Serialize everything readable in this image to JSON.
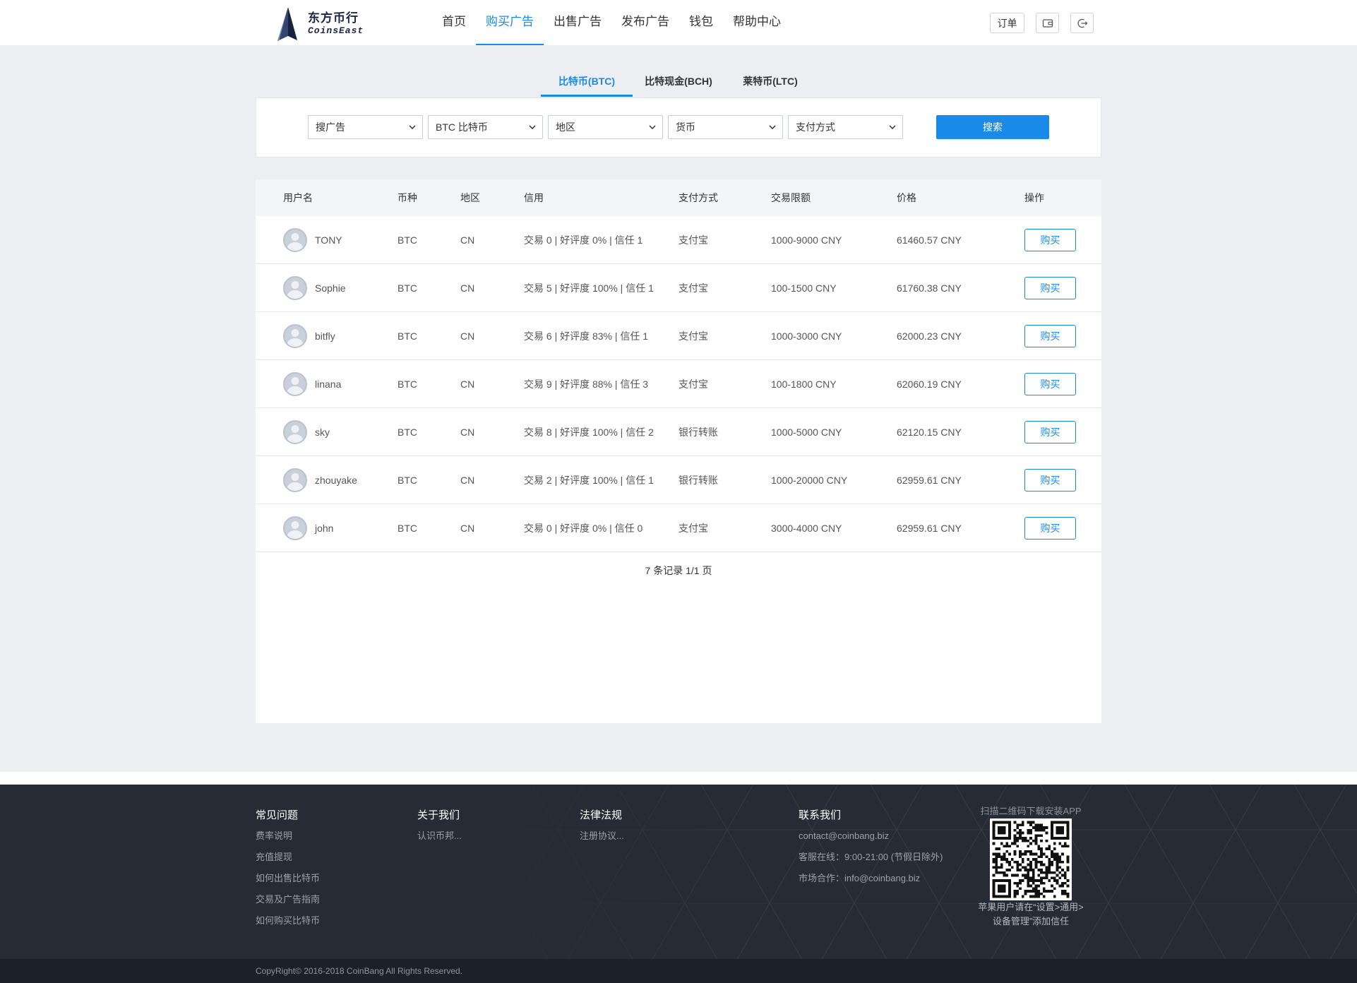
{
  "header": {
    "logo": {
      "name": "东方币行",
      "sub": "CoinsEast"
    },
    "nav": [
      {
        "label": "首页"
      },
      {
        "label": "购买广告",
        "active": true
      },
      {
        "label": "出售广告"
      },
      {
        "label": "发布广告"
      },
      {
        "label": "钱包"
      },
      {
        "label": "帮助中心"
      }
    ],
    "actions": {
      "orders_label": "订单",
      "wallet_icon": "wallet-icon",
      "logout_icon": "logout-icon"
    }
  },
  "coin_tabs": [
    {
      "label": "比特币(BTC)",
      "active": true
    },
    {
      "label": "比特现金(BCH)"
    },
    {
      "label": "莱特币(LTC)"
    }
  ],
  "filters": {
    "selects": [
      {
        "value": "搜广告"
      },
      {
        "value": "BTC 比特币"
      },
      {
        "value": "地区"
      },
      {
        "value": "货币"
      },
      {
        "value": "支付方式"
      }
    ],
    "search_label": "搜索"
  },
  "table": {
    "columns": [
      "用户名",
      "币种",
      "地区",
      "信用",
      "支付方式",
      "交易限额",
      "价格",
      "操作"
    ],
    "action_label": "购买",
    "rows": [
      {
        "user": "TONY",
        "coin": "BTC",
        "region": "CN",
        "credit": "交易 0 | 好评度 0% | 信任 1",
        "payment": "支付宝",
        "limit": "1000-9000 CNY",
        "price": "61460.57 CNY"
      },
      {
        "user": "Sophie",
        "coin": "BTC",
        "region": "CN",
        "credit": "交易 5 | 好评度 100% | 信任 1",
        "payment": "支付宝",
        "limit": "100-1500 CNY",
        "price": "61760.38 CNY"
      },
      {
        "user": "bitfly",
        "coin": "BTC",
        "region": "CN",
        "credit": "交易 6 | 好评度 83% | 信任 1",
        "payment": "支付宝",
        "limit": "1000-3000 CNY",
        "price": "62000.23 CNY"
      },
      {
        "user": "linana",
        "coin": "BTC",
        "region": "CN",
        "credit": "交易 9 | 好评度 88% | 信任 3",
        "payment": "支付宝",
        "limit": "100-1800 CNY",
        "price": "62060.19 CNY"
      },
      {
        "user": "sky",
        "coin": "BTC",
        "region": "CN",
        "credit": "交易 8 | 好评度 100% | 信任 2",
        "payment": "银行转账",
        "limit": "1000-5000 CNY",
        "price": "62120.15 CNY"
      },
      {
        "user": "zhouyake",
        "coin": "BTC",
        "region": "CN",
        "credit": "交易 2 | 好评度 100% | 信任 1",
        "payment": "银行转账",
        "limit": "1000-20000 CNY",
        "price": "62959.61 CNY"
      },
      {
        "user": "john",
        "coin": "BTC",
        "region": "CN",
        "credit": "交易 0 | 好评度 0% | 信任 0",
        "payment": "支付宝",
        "limit": "3000-4000 CNY",
        "price": "62959.61 CNY"
      }
    ]
  },
  "pagination": {
    "text": "7 条记录 1/1 页"
  },
  "footer": {
    "faq": {
      "title": "常见问题",
      "items": [
        "费率说明",
        "充值提现",
        "如何出售比特币",
        "交易及广告指南",
        "如何购买比特币"
      ]
    },
    "about": {
      "title": "关于我们",
      "items": [
        "认识币邦..."
      ]
    },
    "legal": {
      "title": "法律法规",
      "items": [
        "注册协议..."
      ]
    },
    "contact": {
      "title": "联系我们",
      "items": [
        "contact@coinbang.biz",
        "客服在线：9:00-21:00 (节假日除外)",
        "市场合作：info@coinbang.biz"
      ]
    },
    "app": {
      "title": "扫描二维码下载安装APP",
      "note_lines": [
        "苹果用户请在“设置>通用>",
        "设备管理”添加信任"
      ]
    }
  },
  "copyright": "CopyRight© 2016-2018 CoinBang All Rights Reserved.",
  "colors": {
    "accent": "#1a8ae8",
    "page_bg": "#eceef1",
    "footer_bg": "#262b35",
    "footer_bottom_bg": "#1c2028"
  },
  "icons": [
    "logo-sail-icon",
    "wallet-icon",
    "logout-icon",
    "chevron-down-icon",
    "avatar",
    "qr-code"
  ]
}
